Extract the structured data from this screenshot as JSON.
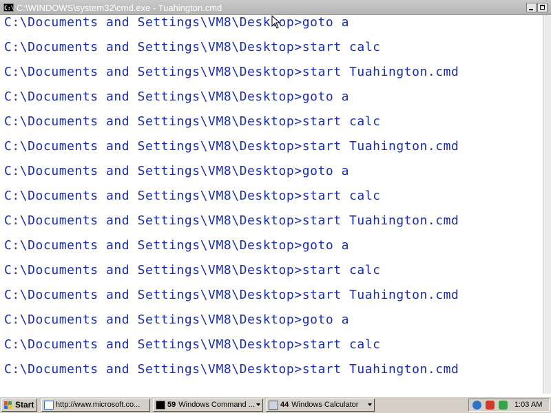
{
  "window": {
    "title": "C:\\WINDOWS\\system32\\cmd.exe - Tuahington.cmd",
    "icon_label": "C:\\",
    "minimize_icon": "minimize-icon",
    "maximize_icon": "maximize-icon"
  },
  "console": {
    "text_color": "#1a2db0",
    "background": "#ffffff",
    "lines": [
      "C:\\Documents and Settings\\VM8\\Desktop>goto a",
      "C:\\Documents and Settings\\VM8\\Desktop>start calc",
      "C:\\Documents and Settings\\VM8\\Desktop>start Tuahington.cmd",
      "C:\\Documents and Settings\\VM8\\Desktop>goto a",
      "C:\\Documents and Settings\\VM8\\Desktop>start calc",
      "C:\\Documents and Settings\\VM8\\Desktop>start Tuahington.cmd",
      "C:\\Documents and Settings\\VM8\\Desktop>goto a",
      "C:\\Documents and Settings\\VM8\\Desktop>start calc",
      "C:\\Documents and Settings\\VM8\\Desktop>start Tuahington.cmd",
      "C:\\Documents and Settings\\VM8\\Desktop>goto a",
      "C:\\Documents and Settings\\VM8\\Desktop>start calc",
      "C:\\Documents and Settings\\VM8\\Desktop>start Tuahington.cmd",
      "C:\\Documents and Settings\\VM8\\Desktop>goto a",
      "C:\\Documents and Settings\\VM8\\Desktop>start calc",
      "C:\\Documents and Settings\\VM8\\Desktop>start Tuahington.cmd"
    ]
  },
  "taskbar": {
    "start_label": "Start",
    "buttons": [
      {
        "count": "",
        "label": "http://www.microsoft.co...",
        "icon": "ie-page-icon",
        "has_arrow": false
      },
      {
        "count": "59",
        "label": "Windows Command ...",
        "icon": "cmd-icon",
        "has_arrow": true
      },
      {
        "count": "44",
        "label": "Windows Calculator",
        "icon": "calculator-icon",
        "has_arrow": true
      }
    ],
    "tray_icons": [
      "network-icon",
      "security-shield-icon",
      "update-icon"
    ],
    "clock": "1:03 AM"
  }
}
